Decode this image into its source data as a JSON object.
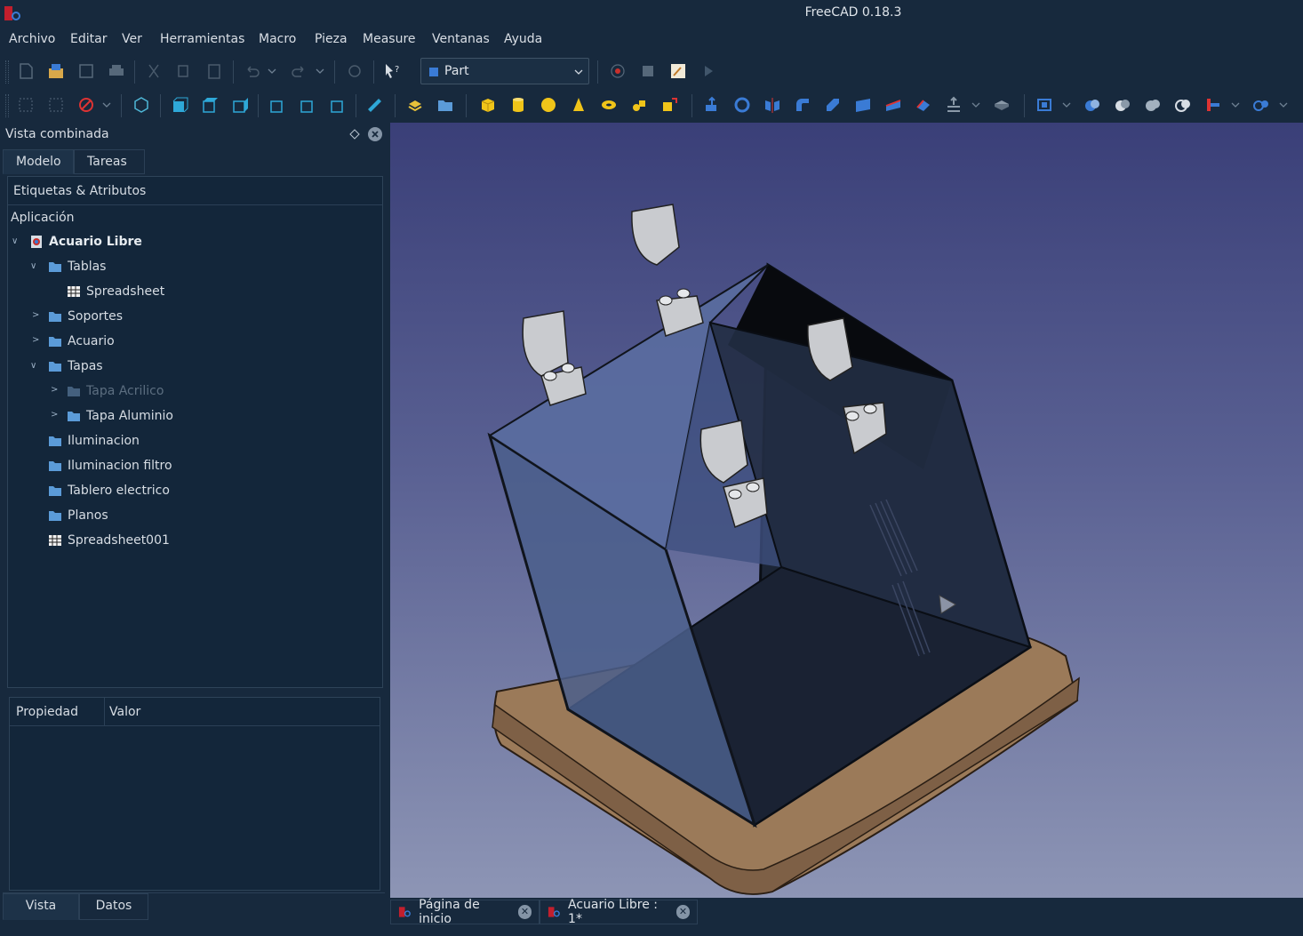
{
  "window": {
    "title": "FreeCAD 0.18.3",
    "logo_icon": "freecad-logo-icon"
  },
  "menu": [
    "Archivo",
    "Editar",
    "Ver",
    "Herramientas",
    "Macro",
    "Pieza",
    "Measure",
    "Ventanas",
    "Ayuda"
  ],
  "toolbar": {
    "workbench_selected": "Part"
  },
  "combo_view": {
    "title": "Vista combinada",
    "tabs": [
      "Modelo",
      "Tareas"
    ],
    "tree_header": "Etiquetas & Atributos",
    "app_label": "Aplicación",
    "tree": [
      {
        "label": "Acuario Libre",
        "icon": "document-icon"
      },
      {
        "label": "Tablas",
        "icon": "folder-icon"
      },
      {
        "label": "Spreadsheet",
        "icon": "spreadsheet-icon"
      },
      {
        "label": "Soportes",
        "icon": "folder-icon"
      },
      {
        "label": "Acuario",
        "icon": "folder-icon"
      },
      {
        "label": "Tapas",
        "icon": "folder-icon"
      },
      {
        "label": "Tapa Acrilico",
        "icon": "folder-icon"
      },
      {
        "label": "Tapa Aluminio",
        "icon": "folder-icon"
      },
      {
        "label": "Iluminacion",
        "icon": "folder-icon"
      },
      {
        "label": "Iluminacion filtro",
        "icon": "folder-icon"
      },
      {
        "label": "Tablero electrico",
        "icon": "folder-icon"
      },
      {
        "label": "Planos",
        "icon": "folder-icon"
      },
      {
        "label": "Spreadsheet001",
        "icon": "spreadsheet-icon"
      }
    ],
    "property_columns": [
      "Propiedad",
      "Valor"
    ],
    "bottom_tabs": [
      "Vista",
      "Datos"
    ]
  },
  "doc_tabs": [
    {
      "label": "Página de inicio",
      "icon": "freecad-logo-icon"
    },
    {
      "label": "Acuario Libre : 1*",
      "icon": "freecad-logo-icon"
    }
  ],
  "colors": {
    "background": "#17293d",
    "viewport_top": "#3a3f78",
    "viewport_bottom": "#8d95b5",
    "base_wood": "#9b7a59",
    "glass": "#5b6fa0"
  }
}
